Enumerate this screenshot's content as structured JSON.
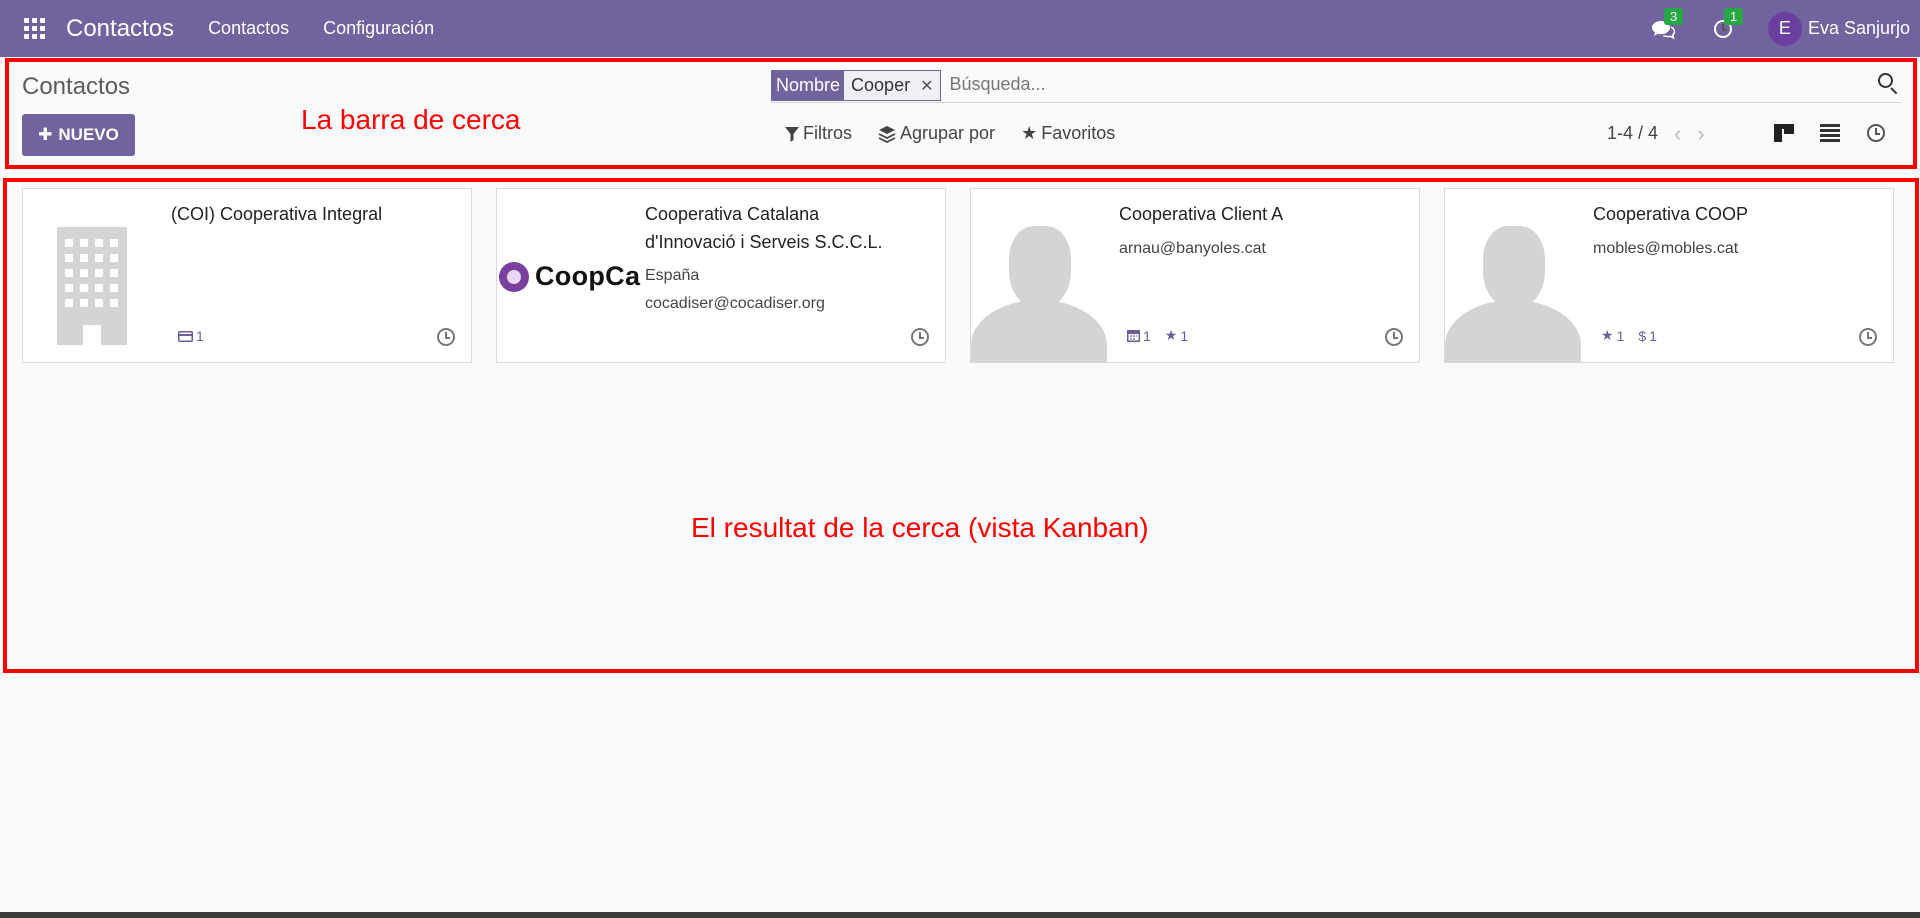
{
  "navbar": {
    "app_name": "Contactos",
    "menu": [
      "Contactos",
      "Configuración"
    ],
    "messages_count": "3",
    "activities_count": "1",
    "user_initial": "E",
    "user_name": "Eva Sanjurjo"
  },
  "control_panel": {
    "title": "Contactos",
    "new_button": "NUEVO",
    "facet_label": "Nombre",
    "facet_value": "Cooper",
    "search_placeholder": "Búsqueda...",
    "filters": "Filtros",
    "group_by": "Agrupar por",
    "favorites": "Favoritos",
    "pager": "1-4 / 4"
  },
  "annotations": {
    "search_bar": "La barra de cerca",
    "results": "El resultat de la cerca (vista Kanban)"
  },
  "cards": [
    {
      "title": "(COI) Cooperativa Integral",
      "badges": [
        "1"
      ]
    },
    {
      "title_line1": "Cooperativa Catalana",
      "title_line2": "d'Innovació i Serveis S.C.C.L.",
      "country": "España",
      "email": "cocadiser@cocadiser.org",
      "logo_text": "CoopCa"
    },
    {
      "title": "Cooperativa Client A",
      "email": "arnau@banyoles.cat",
      "badges": [
        "1",
        "1"
      ]
    },
    {
      "title": "Cooperativa COOP",
      "email": "mobles@mobles.cat",
      "badges": [
        "1",
        "1"
      ]
    }
  ],
  "colors": {
    "brand": "#71639e",
    "annotation": "#ff0000"
  }
}
